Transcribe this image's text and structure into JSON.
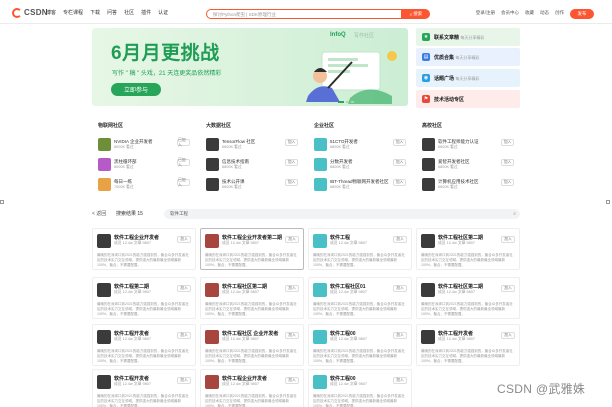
{
  "nav": {
    "logo": "CSDN",
    "items": [
      "博客",
      "专栏课程",
      "下载",
      "问答",
      "社区",
      "插件",
      "认证"
    ],
    "search_placeholder": "探讨Python爬虫 | SDK原理行业",
    "search_button": "搜索",
    "toolbar": [
      "登录/注册",
      "会员中心",
      "收藏",
      "动态",
      "创作"
    ],
    "publish": "发布"
  },
  "banner": {
    "title": "6月月更挑战",
    "subtitle": "写作 \" 稿 \" 头戏，21 天连更奖品依然精彩",
    "button": "立即参与",
    "brand": "InfoQ",
    "brand2": "写作社区"
  },
  "side_cards": [
    {
      "title": "联系文章精",
      "desc": "每天分享精彩",
      "icon": "star-icon",
      "bg": "#e8f5e9",
      "icon_color": "#27a65a"
    },
    {
      "title": "优质合集",
      "desc": "每天分享精彩",
      "icon": "book-icon",
      "bg": "#e8f1fd",
      "icon_color": "#3a7de6"
    },
    {
      "title": "话题广场",
      "desc": "每天分享精彩",
      "icon": "chat-icon",
      "bg": "#e6f3fc",
      "icon_color": "#2a9ee4"
    },
    {
      "title": "技术活动专区",
      "desc": "",
      "icon": "flag-icon",
      "bg": "#fdecea",
      "icon_color": "#e8483b"
    }
  ],
  "communities": [
    {
      "heading": "物联网社区",
      "items": [
        {
          "name": "NVIDIA 企业开发者",
          "meta": "8000K 看过",
          "join": "已加入",
          "color": "#6d8f3a"
        },
        {
          "name": "黑柱循环部",
          "meta": "8000K 看过",
          "join": "已加入",
          "color": "#b65ac8"
        },
        {
          "name": "每日一练",
          "meta": "7000K 看过",
          "join": "已加入",
          "color": "#e7a343"
        }
      ]
    },
    {
      "heading": "大数据社区",
      "items": [
        {
          "name": "TensorFlow 社区",
          "meta": "6800K 看过",
          "join": "加入",
          "color": "#3b3b3b"
        },
        {
          "name": "信息技术指南",
          "meta": "6800K 看过",
          "join": "加入",
          "color": "#3b3b3b"
        },
        {
          "name": "技术公开课",
          "meta": "6800K 看过",
          "join": "加入",
          "color": "#3b3b3b"
        }
      ]
    },
    {
      "heading": "企业社区",
      "items": [
        {
          "name": "51CTO开发者",
          "meta": "6800K 看过",
          "join": "加入",
          "color": "#48c0c6"
        },
        {
          "name": "分数开发者",
          "meta": "6800K 看过",
          "join": "加入",
          "color": "#48c0c6"
        },
        {
          "name": "IBT-Thread物联网开发者社区",
          "meta": "6800K 看过",
          "join": "加入",
          "color": "#48c0c6"
        }
      ]
    },
    {
      "heading": "高校社区",
      "items": [
        {
          "name": "软件工程师能力认证",
          "meta": "6800K 看过",
          "join": "加入",
          "color": "#3b3b3b"
        },
        {
          "name": "爱智开发者社区",
          "meta": "6800K 看过",
          "join": "加入",
          "color": "#3b3b3b"
        },
        {
          "name": "计算机应用技术社区",
          "meta": "6800K 看过",
          "join": "加入",
          "color": "#3b3b3b"
        }
      ]
    }
  ],
  "results": {
    "back": "< 返回",
    "count": "搜索结果 15",
    "query": "软件工程"
  },
  "cards": [
    {
      "title": "软件工程企业开发者",
      "meta": "成员 12.4w  文章 9807",
      "color": "#3b3b3b"
    },
    {
      "title": "软件工程企业开发者第二期",
      "meta": "成员 12.4w  文章 9807",
      "color": "#a6463e"
    },
    {
      "title": "软件工程",
      "meta": "成员 12.4w  文章 9807",
      "color": "#48c0c6"
    },
    {
      "title": "软件工程社区第二期",
      "meta": "成员 12.4w  文章 9807",
      "color": "#3b3b3b"
    },
    {
      "title": "软件工程第二期",
      "meta": "成员 12.4w  文章 9807",
      "color": "#3b3b3b"
    },
    {
      "title": "软件工程社区第二期",
      "meta": "成员 12.4w  文章 9807",
      "color": "#a6463e"
    },
    {
      "title": "软件工程社区01",
      "meta": "成员 12.4w  文章 9807",
      "color": "#48c0c6"
    },
    {
      "title": "软件工程社区第二期",
      "meta": "成员 12.4w  文章 9807",
      "color": "#3b3b3b"
    },
    {
      "title": "软件工程开发者",
      "meta": "成员 12.4w  文章 9807",
      "color": "#3b3b3b"
    },
    {
      "title": "软件工程社区 企业开发者",
      "meta": "成员 12.4w  文章 9807",
      "color": "#a6463e"
    },
    {
      "title": "软件工程00",
      "meta": "成员 12.4w  文章 9807",
      "color": "#48c0c6"
    },
    {
      "title": "软件工程开发者",
      "meta": "成员 12.4w  文章 9807",
      "color": "#3b3b3b"
    },
    {
      "title": "软件工程开发者",
      "meta": "成员 12.4w  文章 9807",
      "color": "#3b3b3b"
    },
    {
      "title": "软件工程企业开发者",
      "meta": "成员 12.4w  文章 9807",
      "color": "#a6463e"
    },
    {
      "title": "软件工程00",
      "meta": "成员 12.4w  文章 9807",
      "color": "#48c0c6"
    }
  ],
  "card_desc": "最晚的在深圳口到2021的能力强强到的，聚合众多开发者社区的技术实力交互领域，提供强大的最新最全领域最新100%，聚合，不需要配置。",
  "card_join": "加入",
  "watermark": "CSDN @武雅姝"
}
